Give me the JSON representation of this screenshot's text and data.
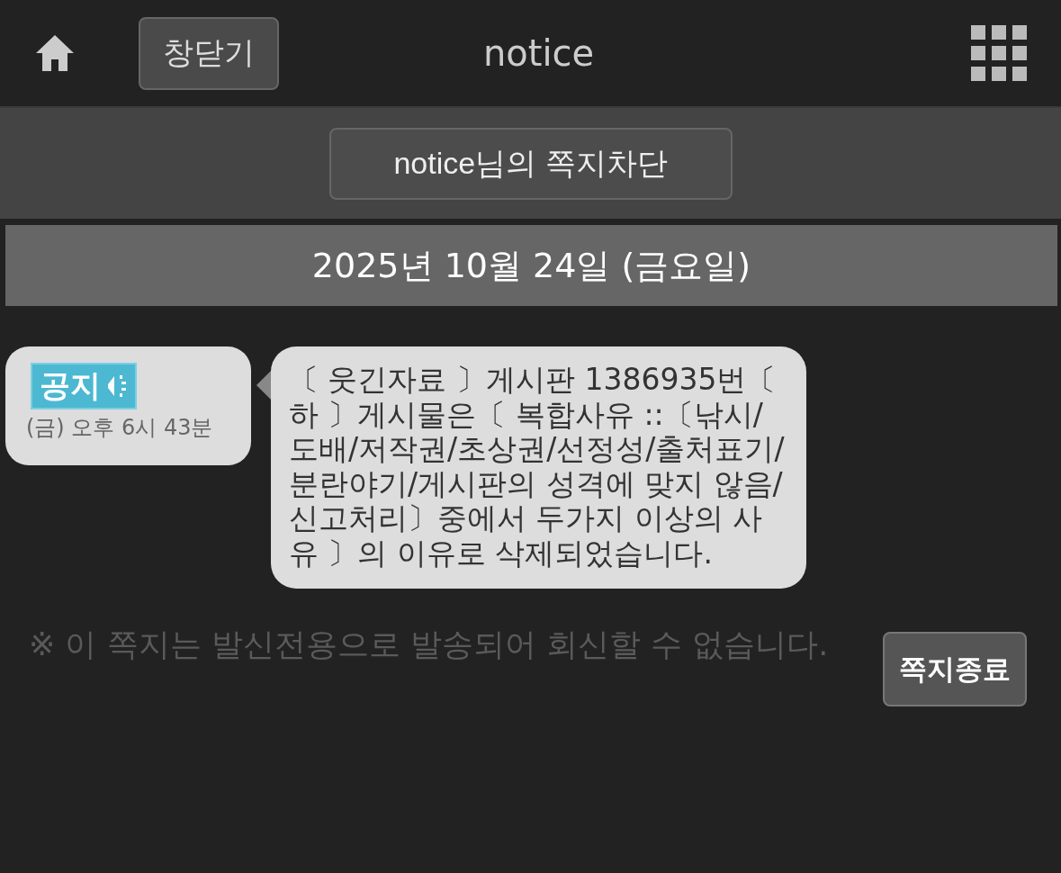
{
  "header": {
    "close_button": "창닫기",
    "title": "notice"
  },
  "block_button": "notice님의 쪽지차단",
  "date": "2025년 10월 24일 (금요일)",
  "message": {
    "badge": "공지",
    "time": "(금) 오후 6시 43분",
    "text": "〔 웃긴자료 〕게시판 1386935번〔 하 〕게시물은〔 복합사유 ::〔낚시/도배/저작권/초상권/선정성/출처표기/분란야기/게시판의 성격에 맞지 않음/신고처리〕중에서 두가지 이상의 사유 〕의 이유로 삭제되었습니다."
  },
  "footer": {
    "notice": "※ 이 쪽지는 발신전용으로 발송되어 회신할 수 없습니다.",
    "button": "쪽지종료"
  }
}
